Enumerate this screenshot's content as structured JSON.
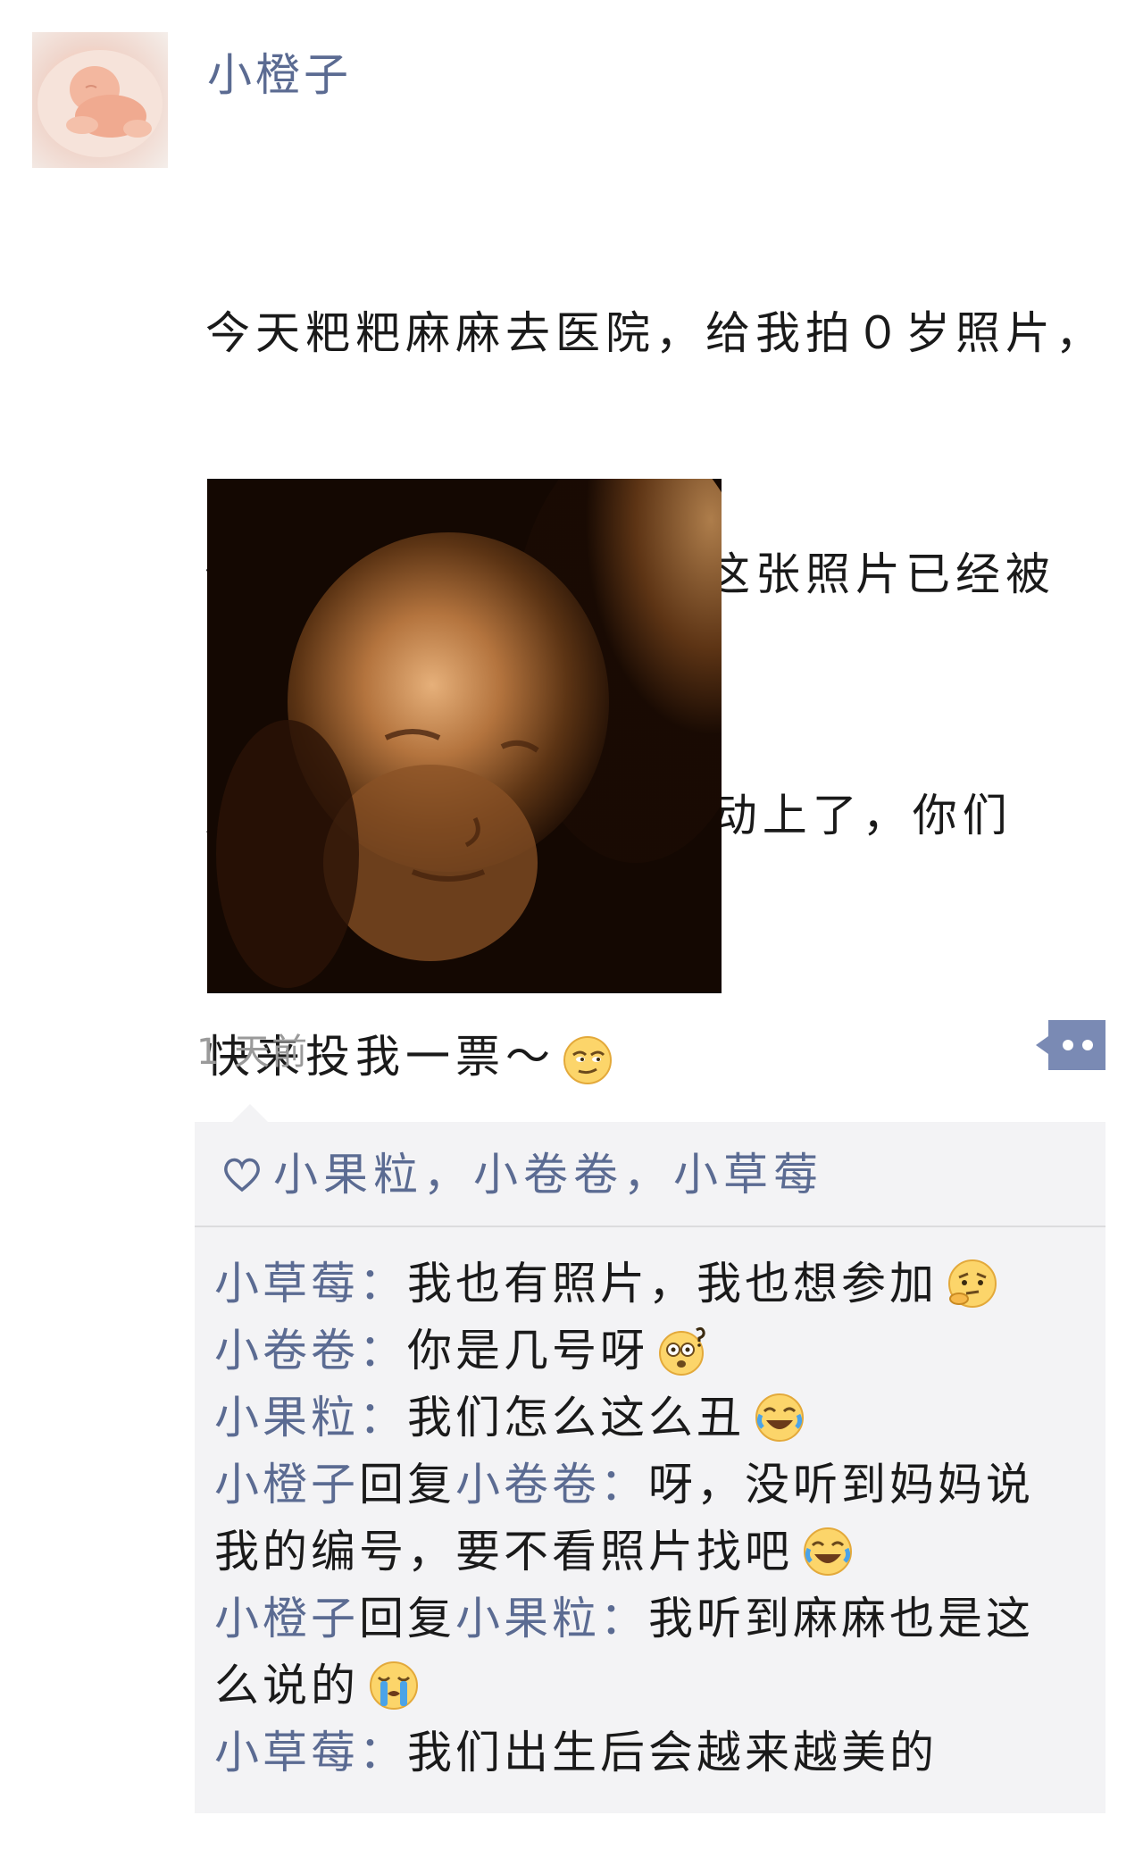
{
  "post": {
    "author": "小橙子",
    "text_lines": [
      "今天粑粑麻麻去医院，给我拍０岁照片，",
      "你们看我还没睡醒呢。这张照片已经被",
      "麻麻放在“四维萌宝”活动上了，你们",
      "快来投我一票～"
    ],
    "text_emoji": "smirk-emoji-icon",
    "photo_icon": "ultrasound-baby-photo",
    "timestamp": "1 天前",
    "comment_button_icon": "comment-dots-icon"
  },
  "likes": {
    "icon": "heart-outline-icon",
    "names": "小果粒，小卷卷，小草莓"
  },
  "comments": [
    {
      "name": "小草莓",
      "sep": "：",
      "text": "我也有照片，我也想参加",
      "emoji": "thinking-emoji-icon"
    },
    {
      "name": "小卷卷",
      "sep": "：",
      "text": "你是几号呀",
      "emoji": "dizzy-question-emoji-icon"
    },
    {
      "name": "小果粒",
      "sep": "：",
      "text": "我们怎么这么丑",
      "emoji": "laughing-crying-emoji-icon"
    },
    {
      "name": "小橙子",
      "reply_word": "回复",
      "reply_to": "小卷卷",
      "sep": "：",
      "text": "呀，没听到妈妈说我的编号，要不看照片找吧",
      "emoji": "laughing-crying-emoji-icon"
    },
    {
      "name": "小橙子",
      "reply_word": "回复",
      "reply_to": "小果粒",
      "sep": "：",
      "text": "我听到麻麻也是这么说的",
      "emoji": "crying-emoji-icon"
    },
    {
      "name": "小草莓",
      "sep": "：",
      "text": "我们出生后会越来越美的"
    }
  ],
  "colors": {
    "name_link": "#5b6b92",
    "panel_bg": "#f3f3f5",
    "timestamp": "#9a9a9a"
  }
}
